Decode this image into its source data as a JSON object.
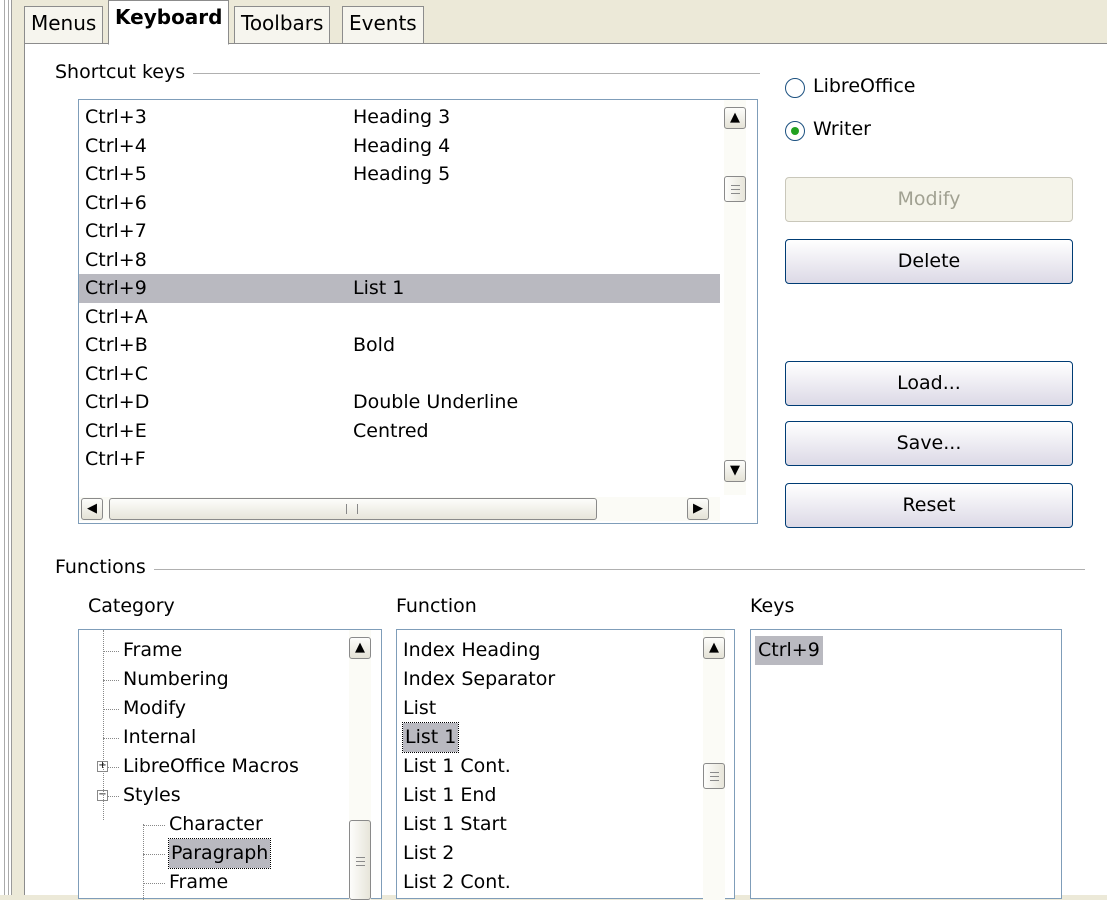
{
  "tabs": [
    "Menus",
    "Keyboard",
    "Toolbars",
    "Events"
  ],
  "shortcut_keys": {
    "title": "Shortcut keys",
    "rows": [
      {
        "key": "Ctrl+3",
        "command": "Heading 3"
      },
      {
        "key": "Ctrl+4",
        "command": "Heading 4"
      },
      {
        "key": "Ctrl+5",
        "command": "Heading 5"
      },
      {
        "key": "Ctrl+6",
        "command": ""
      },
      {
        "key": "Ctrl+7",
        "command": ""
      },
      {
        "key": "Ctrl+8",
        "command": ""
      },
      {
        "key": "Ctrl+9",
        "command": "List 1"
      },
      {
        "key": "Ctrl+A",
        "command": ""
      },
      {
        "key": "Ctrl+B",
        "command": "Bold"
      },
      {
        "key": "Ctrl+C",
        "command": ""
      },
      {
        "key": "Ctrl+D",
        "command": "Double Underline"
      },
      {
        "key": "Ctrl+E",
        "command": "Centred"
      },
      {
        "key": "Ctrl+F",
        "command": ""
      }
    ],
    "selected_key": "Ctrl+9"
  },
  "scope": {
    "options": [
      "LibreOffice",
      "Writer"
    ],
    "selected": "Writer"
  },
  "buttons": {
    "modify": "Modify",
    "delete": "Delete",
    "load": "Load...",
    "save": "Save...",
    "reset": "Reset"
  },
  "functions": {
    "title": "Functions",
    "category_label": "Category",
    "function_label": "Function",
    "keys_label": "Keys",
    "category_items": [
      {
        "label": "Frame",
        "level": 1
      },
      {
        "label": "Numbering",
        "level": 1
      },
      {
        "label": "Modify",
        "level": 1
      },
      {
        "label": "Internal",
        "level": 1
      },
      {
        "label": "LibreOffice Macros",
        "level": 0,
        "expander": "+"
      },
      {
        "label": "Styles",
        "level": 0,
        "expander": "−"
      },
      {
        "label": "Character",
        "level": 2
      },
      {
        "label": "Paragraph",
        "level": 2
      },
      {
        "label": "Frame",
        "level": 2
      }
    ],
    "selected_category": "Paragraph",
    "function_items": [
      "Index Heading",
      "Index Separator",
      "List",
      "List 1",
      "List 1 Cont.",
      "List 1 End",
      "List 1 Start",
      "List 2",
      "List 2 Cont."
    ],
    "selected_function": "List 1",
    "keys_items": [
      "Ctrl+9"
    ]
  },
  "icons": {
    "scroll_up": "chevron-up-icon",
    "scroll_down": "chevron-down-icon",
    "scroll_left": "chevron-left-icon",
    "scroll_right": "chevron-right-icon"
  }
}
